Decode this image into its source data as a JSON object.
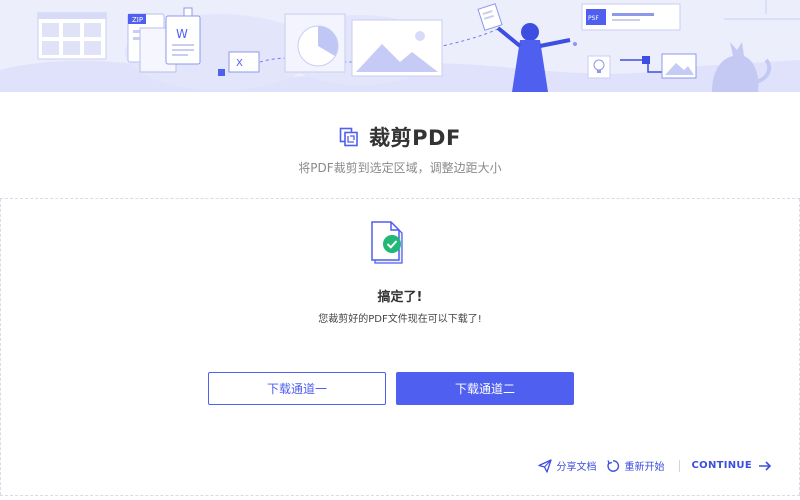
{
  "header": {
    "title": "裁剪PDF",
    "subtitle": "将PDF裁剪到选定区域，调整边距大小"
  },
  "result": {
    "title": "搞定了!",
    "description": "您裁剪好的PDF文件现在可以下载了!"
  },
  "buttons": {
    "download_1": "下载通道一",
    "download_2": "下载通道二"
  },
  "actions": {
    "share": "分享文档",
    "restart": "重新开始",
    "continue": "CONTINUE"
  },
  "illustration": {
    "zip_label": "ZIP",
    "word_label": "W",
    "excel_label": "X",
    "psd_label": "PSF"
  },
  "colors": {
    "accent": "#4f5ff0",
    "hero_bg": "#eceefc",
    "success": "#1fb874"
  }
}
